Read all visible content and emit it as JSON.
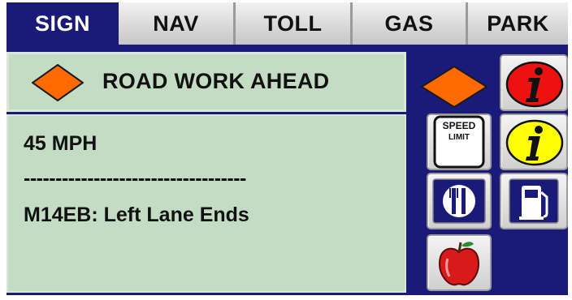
{
  "tabs": [
    {
      "label": "SIGN",
      "active": true
    },
    {
      "label": "NAV",
      "active": false
    },
    {
      "label": "TOLL",
      "active": false
    },
    {
      "label": "GAS",
      "active": false
    },
    {
      "label": "PARK",
      "active": false
    }
  ],
  "header": {
    "icon": "road-work-diamond-icon",
    "title": "ROAD WORK AHEAD"
  },
  "message": {
    "line1": "45 MPH",
    "separator": "-----------------------------------",
    "line2": "M14EB: Left Lane Ends"
  },
  "buttons": {
    "speed_limit": {
      "line1": "SPEED",
      "line2": "LIMIT"
    },
    "icons": [
      "road-work-diamond-icon",
      "red-info-icon",
      "speed-limit-sign-icon",
      "yellow-info-icon",
      "restaurant-icon",
      "gas-pump-icon",
      "apple-icon"
    ]
  },
  "colors": {
    "background": "#1a1a78",
    "panel": "#c3dcc3",
    "diamond": "#ff6a00",
    "info_red": "#ee1111",
    "info_yellow": "#ffff00",
    "apple": "#d81a1a"
  }
}
